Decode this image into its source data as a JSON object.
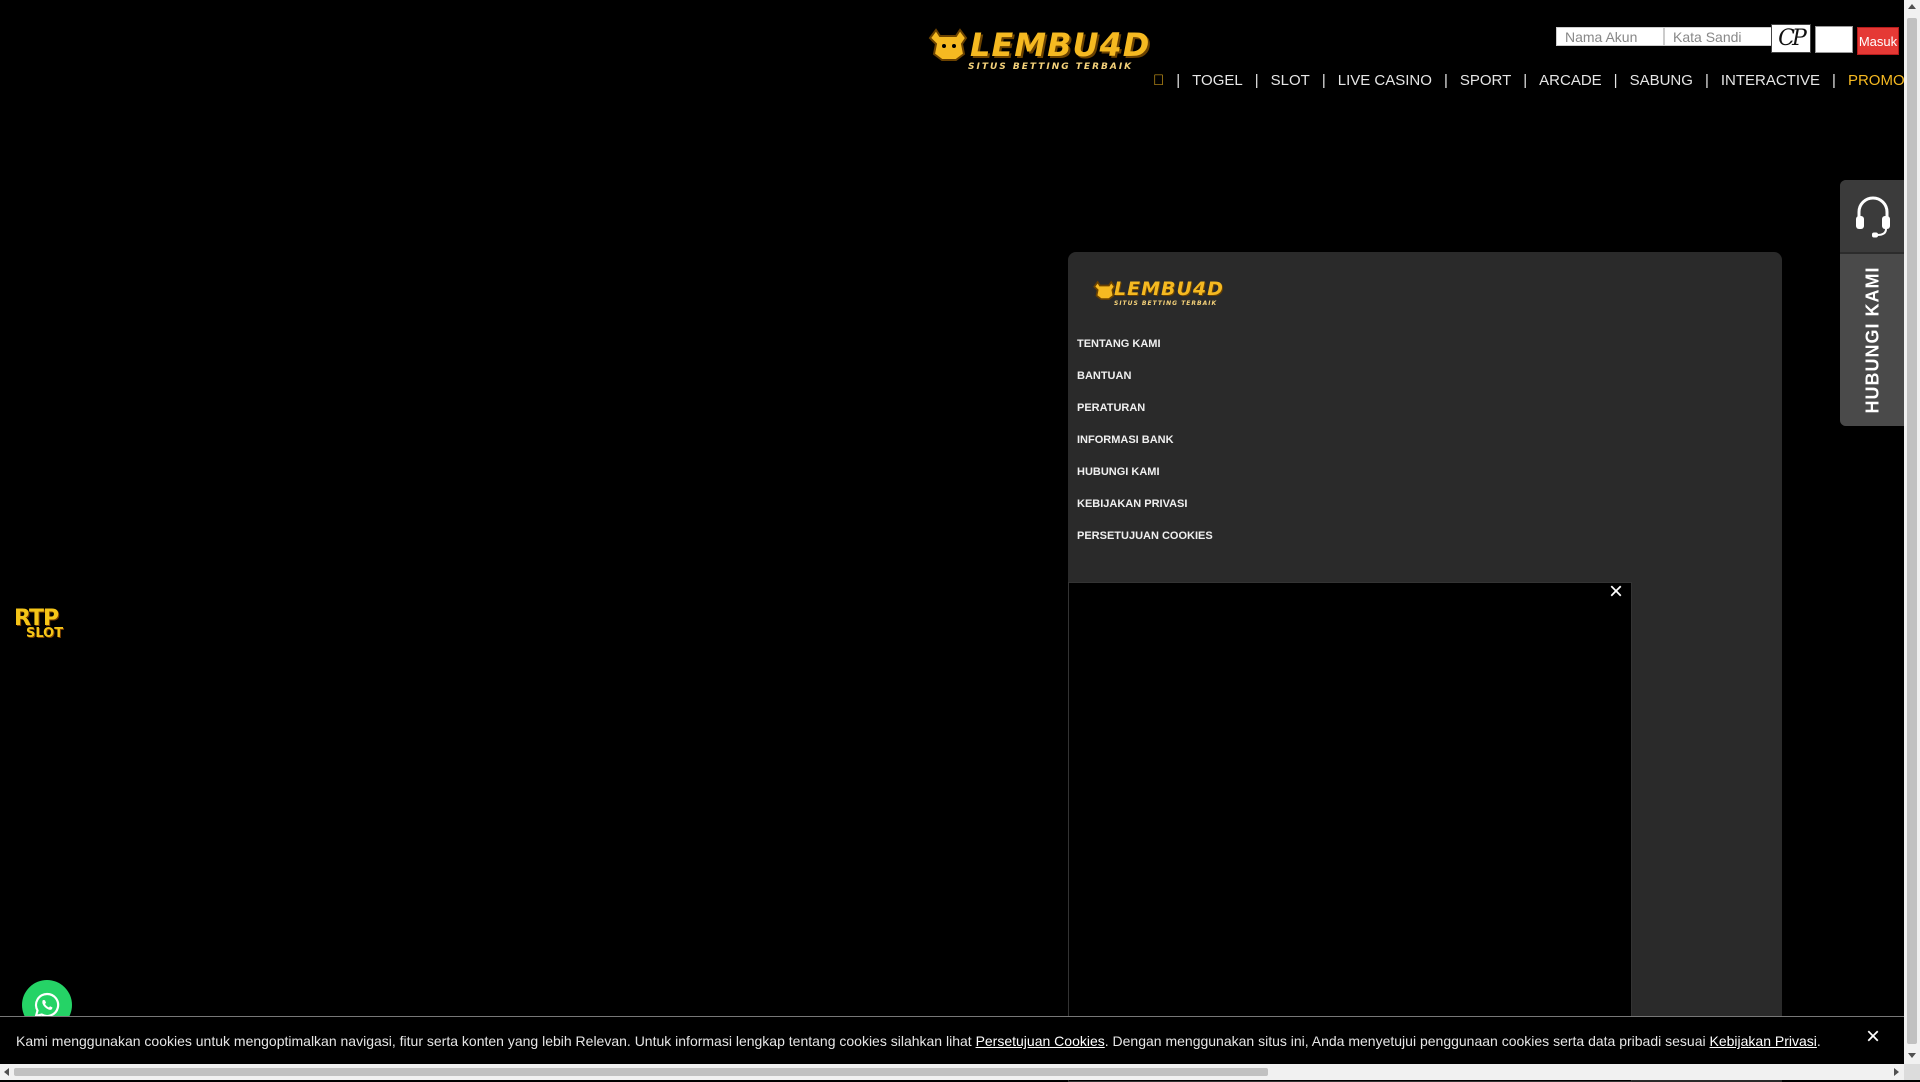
{
  "header": {
    "logo_text": "LEMBU4D",
    "logo_tagline": "SITUS BETTING TERBAIK"
  },
  "login": {
    "username_placeholder": "Nama Akun",
    "password_placeholder": "Kata Sandi",
    "captcha_text": "CP",
    "submit_label": "Masuk"
  },
  "nav": {
    "separator": "|",
    "items": [
      {
        "label": "\u0000"
      },
      {
        "label": "TOGEL"
      },
      {
        "label": "SLOT"
      },
      {
        "label": "LIVE CASINO"
      },
      {
        "label": "SPORT"
      },
      {
        "label": "ARCADE"
      },
      {
        "label": "SABUNG"
      },
      {
        "label": "INTERACTIVE"
      },
      {
        "label": "PROMO"
      }
    ]
  },
  "footer_panel": {
    "logo_text": "LEMBU4D",
    "logo_tagline": "SITUS BETTING TERBAIK",
    "links": [
      "TENTANG KAMI",
      "BANTUAN",
      "PERATURAN",
      "INFORMASI BANK",
      "HUBUNGI KAMI",
      "KEBIJAKAN PRIVASI",
      "PERSETUJUAN COOKIES"
    ]
  },
  "popup": {
    "close_glyph": "×"
  },
  "contact_tab": {
    "label": "HUBUNGI KAMI"
  },
  "rtp_badge": {
    "line1": "RTP",
    "line2": "SLOT"
  },
  "cookie_bar": {
    "text_before": "Kami menggunakan cookies untuk mengoptimalkan navigasi, fitur serta konten yang lebih Relevan. Untuk informasi lengkap tentang cookies silahkan lihat ",
    "link1": "Persetujuan Cookies",
    "text_middle": ". Dengan menggunakan situs ini, Anda menyetujui penggunaan cookies serta data pribadi sesuai ",
    "link2": "Kebijakan Privasi",
    "text_after": ".",
    "close_glyph": "×"
  },
  "colors": {
    "accent_gold": "#f5b921",
    "login_button": "#e53935",
    "panel_bg": "#2a2a2a",
    "whatsapp": "#25d366"
  }
}
